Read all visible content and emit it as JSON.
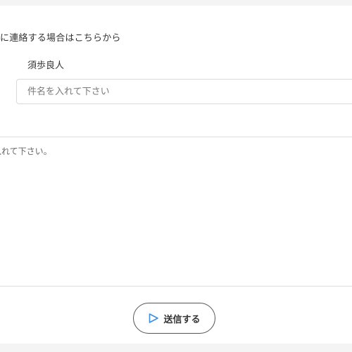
{
  "form": {
    "intro_text": "に連絡する場合はこちらから",
    "recipient_name": "須歩良人",
    "subject_placeholder": "件名を入れて下さい",
    "body_placeholder": "入れて下さい。",
    "send_label": "送信する",
    "send_icon": "send-triangle-icon",
    "accent_color": "#3b8fe0"
  }
}
